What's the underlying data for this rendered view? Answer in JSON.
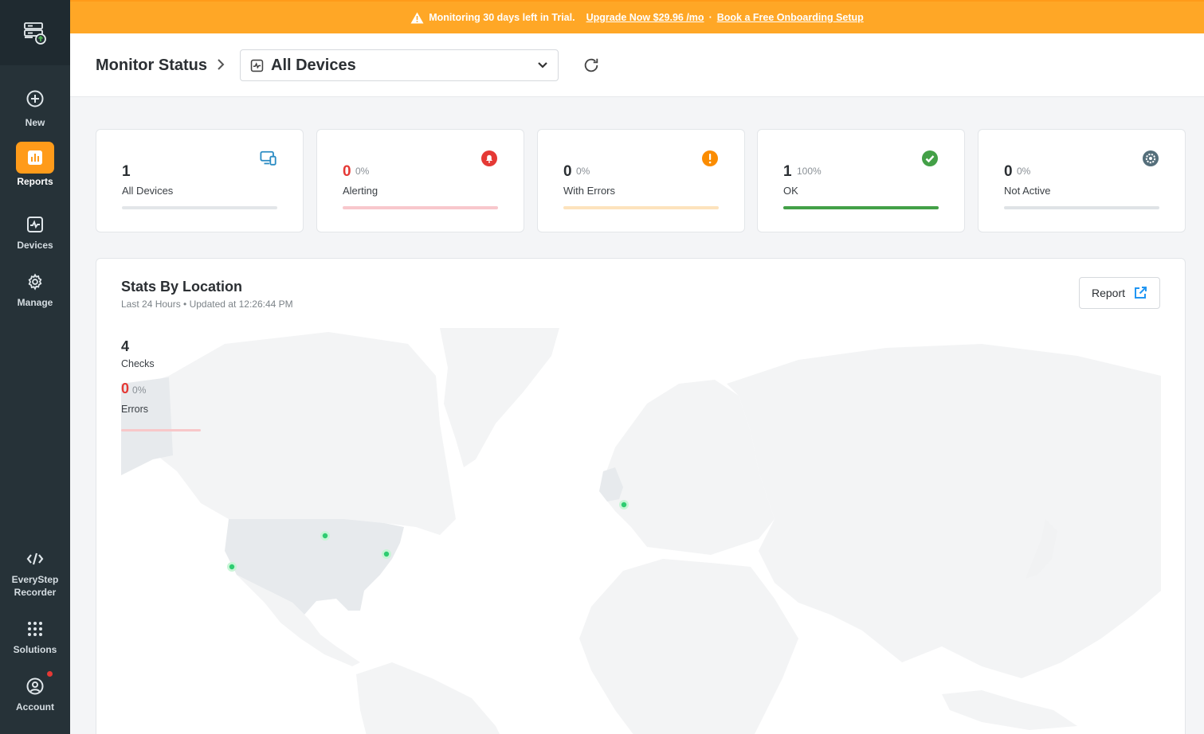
{
  "banner": {
    "trial_text": "Monitoring 30 days left in Trial.",
    "upgrade_link": "Upgrade Now $29.96 /mo",
    "separator": "·",
    "onboarding_link": "Book a Free Onboarding Setup"
  },
  "sidebar": {
    "items": [
      {
        "label": "New",
        "icon": "plus-circle-icon"
      },
      {
        "label": "Reports",
        "icon": "bar-chart-icon",
        "active": true
      },
      {
        "label": "Devices",
        "icon": "devices-icon"
      },
      {
        "label": "Manage",
        "icon": "gear-icon"
      },
      {
        "label": "EveryStep Recorder",
        "icon": "code-icon"
      },
      {
        "label": "Solutions",
        "icon": "grid-icon"
      },
      {
        "label": "Account",
        "icon": "user-circle-icon"
      }
    ]
  },
  "header": {
    "title": "Monitor Status",
    "device_select": "All Devices"
  },
  "cards": [
    {
      "value": "1",
      "percent": "",
      "label": "All Devices",
      "icon": "monitor-icon",
      "color": "#2b8cc4",
      "bar_color": "#e3e6e9",
      "fill": 0
    },
    {
      "value": "0",
      "percent": "0%",
      "label": "Alerting",
      "icon": "bell-icon",
      "color": "#e53935",
      "bar_color": "#f8c7cc",
      "fill": 0
    },
    {
      "value": "0",
      "percent": "0%",
      "label": "With Errors",
      "icon": "exclamation-icon",
      "color": "#fb8c00",
      "bar_color": "#fde3bd",
      "fill": 0
    },
    {
      "value": "1",
      "percent": "100%",
      "label": "OK",
      "icon": "check-icon",
      "color": "#43a047",
      "bar_color": "#43a047",
      "fill": 1
    },
    {
      "value": "0",
      "percent": "0%",
      "label": "Not Active",
      "icon": "gear-icon",
      "color": "#546e7a",
      "bar_color": "#dfe3e6",
      "fill": 0
    }
  ],
  "location": {
    "title": "Stats By Location",
    "subtitle": "Last 24 Hours • Updated at 12:26:44 PM",
    "report_label": "Report",
    "checks_value": "4",
    "checks_label": "Checks",
    "errors_value": "0",
    "errors_percent": "0%",
    "errors_label": "Errors"
  }
}
